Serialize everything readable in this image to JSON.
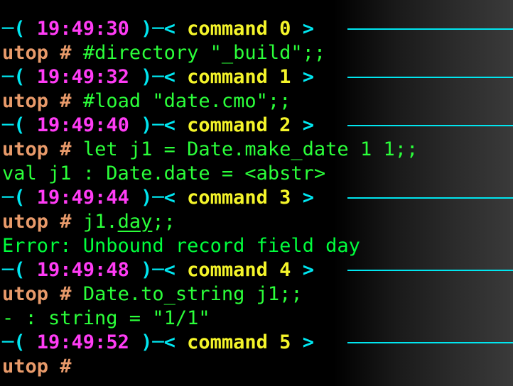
{
  "prompt": "utop #",
  "commands": [
    {
      "time": "19:49:30",
      "label": "command",
      "num": "0",
      "input": "#directory \"_build\";;",
      "output": ""
    },
    {
      "time": "19:49:32",
      "label": "command",
      "num": "1",
      "input": "#load \"date.cmo\";;",
      "output": ""
    },
    {
      "time": "19:49:40",
      "label": "command",
      "num": "2",
      "input": "let j1 = Date.make_date 1 1;;",
      "output": "val j1 : Date.date = <abstr>"
    },
    {
      "time": "19:49:44",
      "label": "command",
      "num": "3",
      "input_pre": "j1.",
      "input_ul": "day",
      "input_post": ";;",
      "output": "Error: Unbound record field day"
    },
    {
      "time": "19:49:48",
      "label": "command",
      "num": "4",
      "input": "Date.to_string j1;;",
      "output": "- : string = \"1/1\""
    },
    {
      "time": "19:49:52",
      "label": "command",
      "num": "5",
      "input": "",
      "output": ""
    }
  ],
  "colors": {
    "background": "#000000",
    "header_punct": "#00e6f0",
    "time": "#ff3cf5",
    "command": "#f5f52a",
    "prompt": "#e89a6a",
    "text": "#2bff3a"
  }
}
